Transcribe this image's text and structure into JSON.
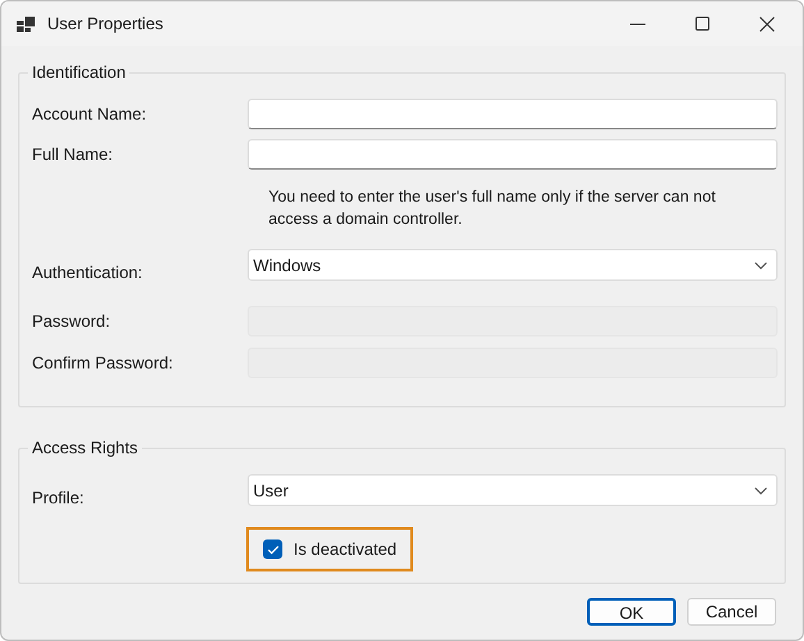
{
  "window": {
    "title": "User Properties"
  },
  "identification": {
    "title": "Identification",
    "name_fields": [
      {
        "label": "Account Name:",
        "kind": "text",
        "disabled": false
      },
      {
        "label": "Full Name:",
        "kind": "text",
        "disabled": false
      }
    ],
    "note": "You need to enter the user's full name only if the server can not access a domain controller.",
    "login_fields": [
      {
        "label": "Authentication:",
        "kind": "select",
        "value": "Windows",
        "disabled": false
      },
      {
        "label": "Password:",
        "kind": "text",
        "disabled": true
      },
      {
        "label": "Confirm Password:",
        "kind": "text",
        "disabled": true
      }
    ]
  },
  "access_rights": {
    "title": "Access Rights",
    "profile": {
      "label": "Profile:",
      "kind": "select",
      "value": "User",
      "disabled": false
    },
    "checkbox": {
      "label": "Is deactivated",
      "checked": true,
      "highlighted": true
    }
  },
  "buttons": [
    {
      "label": "OK",
      "default": true
    },
    {
      "label": "Cancel",
      "default": false
    }
  ]
}
